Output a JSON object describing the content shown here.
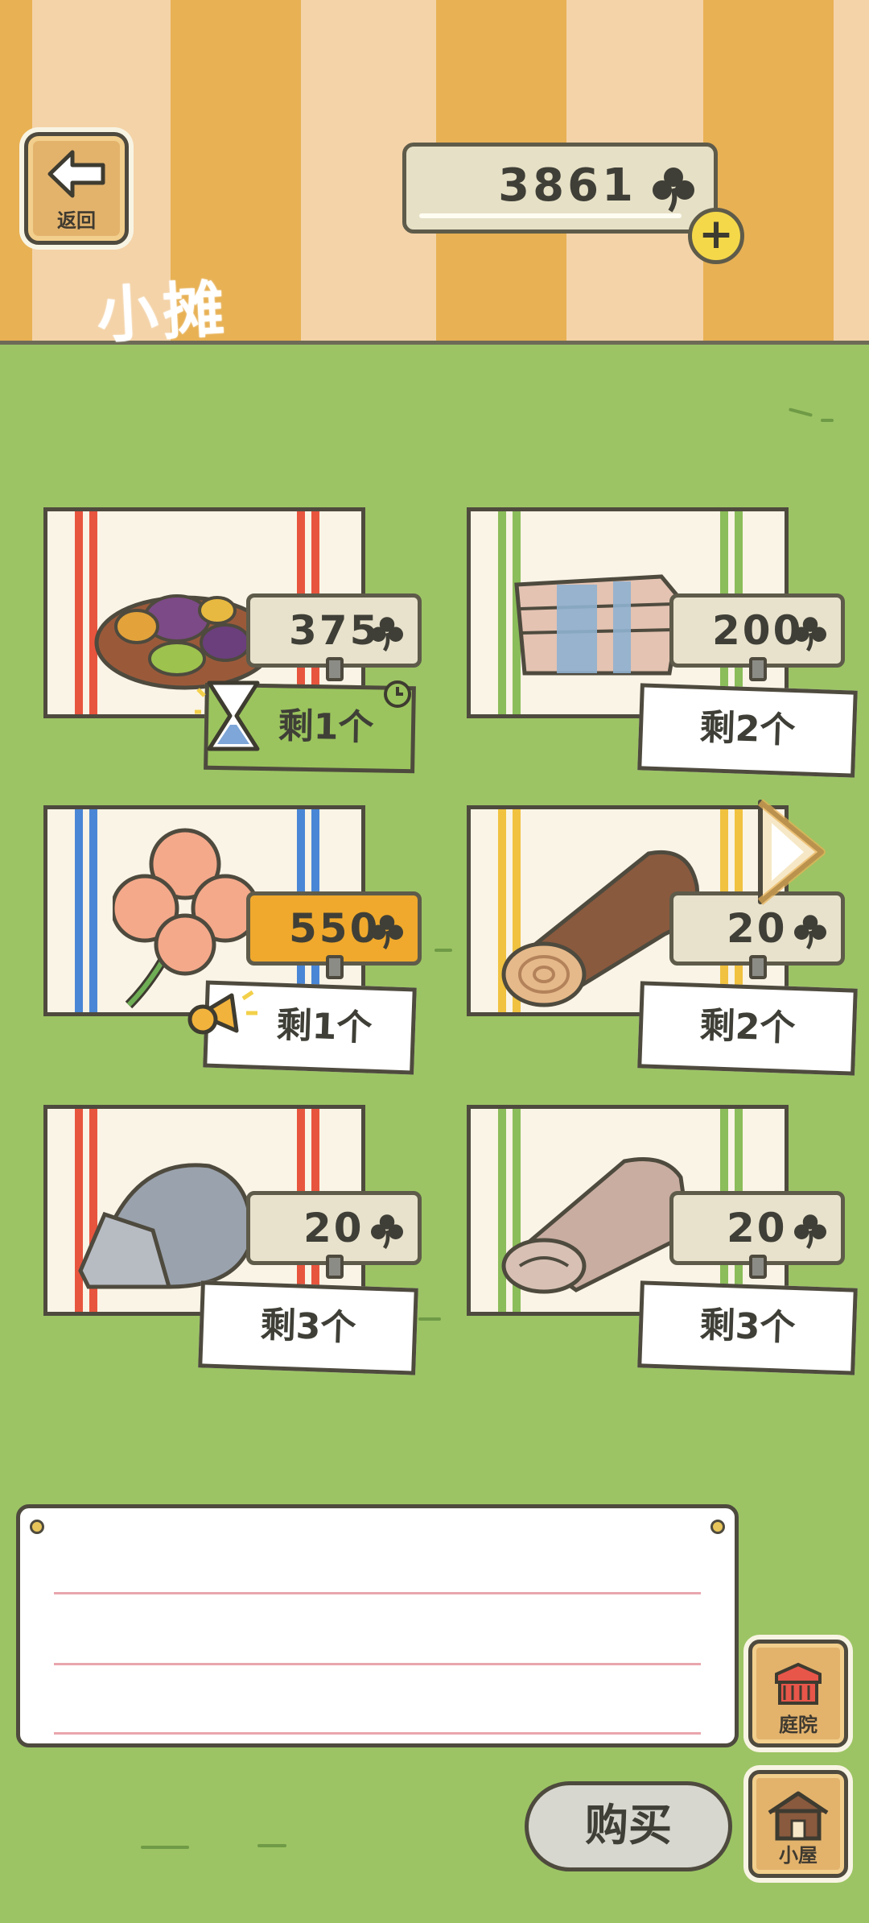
{
  "header": {
    "back_label": "返回",
    "title": "小摊",
    "coins": "3861"
  },
  "items": [
    {
      "name": "vegetable-dish",
      "price": "375",
      "stock": "剩1个",
      "stock_style": "limited-green",
      "badge": "hourglass-icon"
    },
    {
      "name": "folded-cloth",
      "price": "200",
      "stock": "剩2个"
    },
    {
      "name": "four-leaf-clover",
      "price": "550",
      "price_style": "orange",
      "stock": "剩1个",
      "badge": "megaphone-icon"
    },
    {
      "name": "wood-log",
      "price": "20",
      "stock": "剩2个"
    },
    {
      "name": "gray-stone",
      "price": "20",
      "stock": "剩3个"
    },
    {
      "name": "cloth-roll",
      "price": "20",
      "stock": "剩3个"
    }
  ],
  "bottom": {
    "buy_label": "购买",
    "yard_label": "庭院",
    "house_label": "小屋"
  },
  "colors": {
    "grass": "#9cc464",
    "stripe_light": "#f4d3a8",
    "stripe_dark": "#e8b154",
    "price_orange": "#f0a92c",
    "limited_green": "#9bc45e"
  }
}
